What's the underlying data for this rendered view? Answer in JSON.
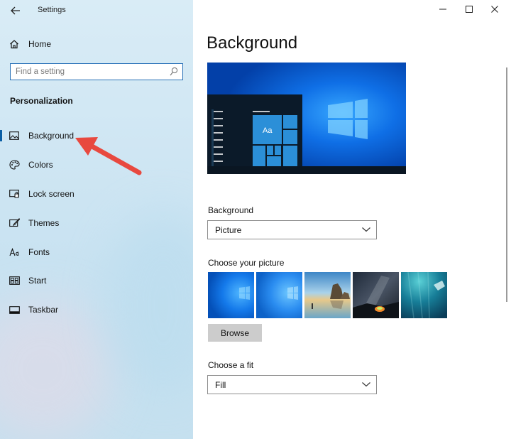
{
  "window": {
    "title": "Settings"
  },
  "sidebar": {
    "home_label": "Home",
    "search_placeholder": "Find a setting",
    "section_title": "Personalization",
    "items": [
      {
        "label": "Background",
        "icon": "image-icon",
        "selected": true
      },
      {
        "label": "Colors",
        "icon": "palette-icon"
      },
      {
        "label": "Lock screen",
        "icon": "lock-screen-icon"
      },
      {
        "label": "Themes",
        "icon": "brush-icon"
      },
      {
        "label": "Fonts",
        "icon": "font-icon"
      },
      {
        "label": "Start",
        "icon": "start-icon"
      },
      {
        "label": "Taskbar",
        "icon": "taskbar-icon"
      }
    ]
  },
  "main": {
    "title": "Background",
    "preview_tile_text": "Aa",
    "background_label": "Background",
    "background_value": "Picture",
    "picture_label": "Choose your picture",
    "browse_label": "Browse",
    "fit_label": "Choose a fit",
    "fit_value": "Fill"
  },
  "colors": {
    "accent": "#0b5fa5",
    "arrow": "#e8493f"
  }
}
